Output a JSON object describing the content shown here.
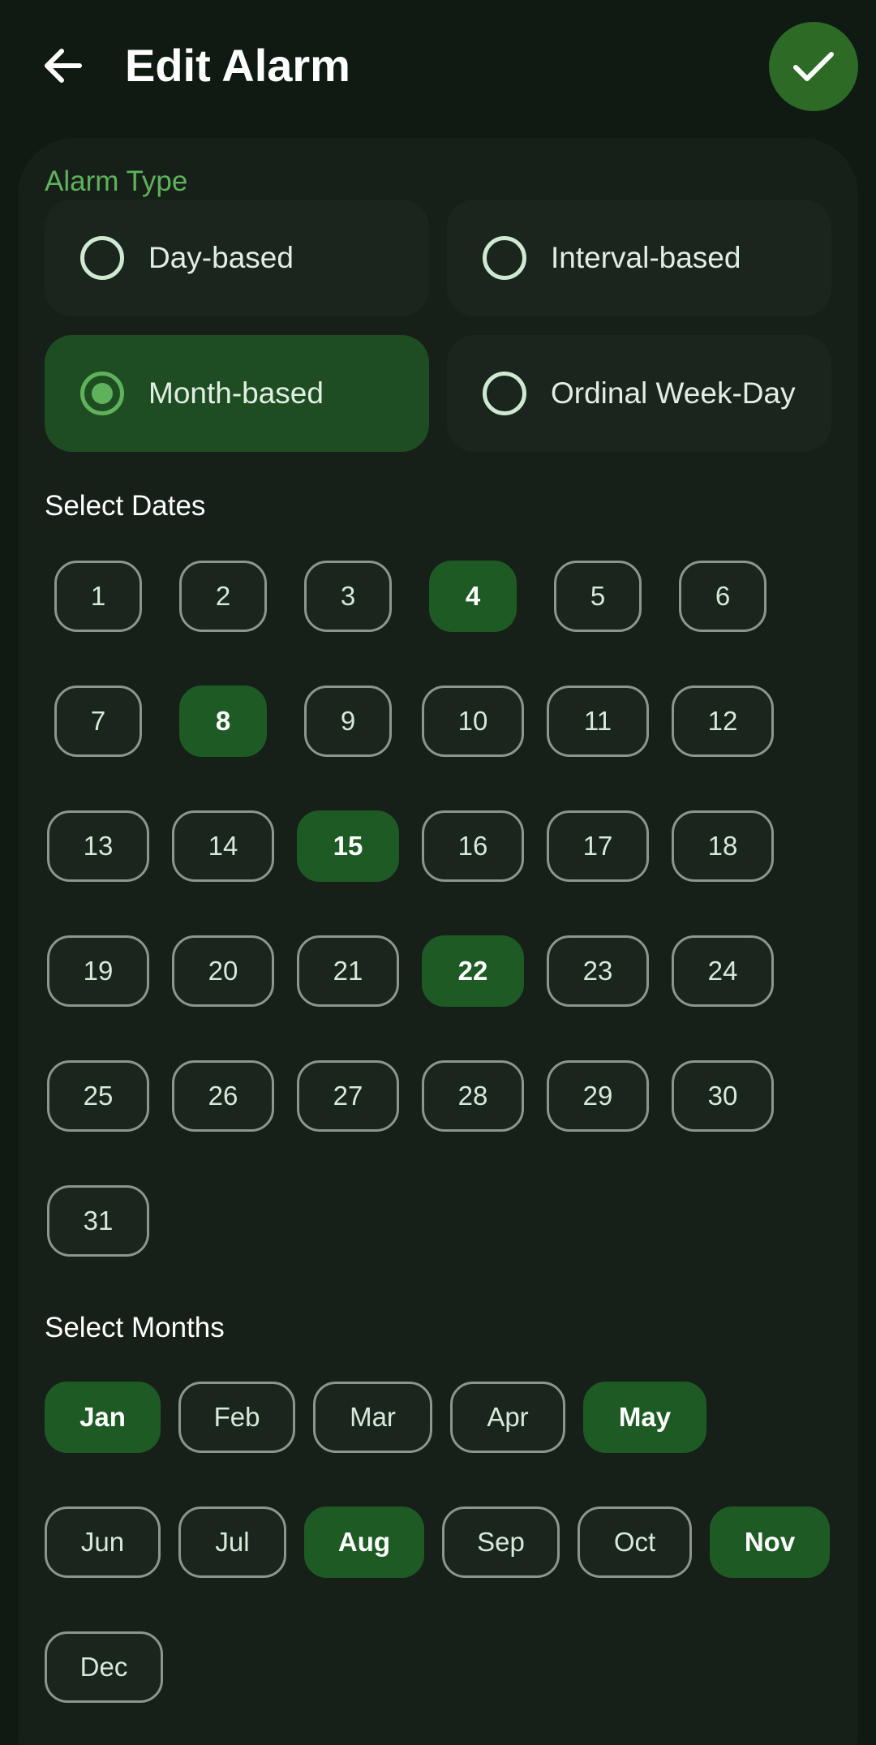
{
  "header": {
    "title": "Edit Alarm",
    "back_icon": "arrow-left-icon",
    "save_icon": "check-icon"
  },
  "alarm_type": {
    "label": "Alarm Type",
    "options": [
      {
        "label": "Day-based",
        "selected": false
      },
      {
        "label": "Interval-based",
        "selected": false
      },
      {
        "label": "Month-based",
        "selected": true
      },
      {
        "label": "Ordinal Week-Day",
        "selected": false
      }
    ]
  },
  "dates": {
    "label": "Select Dates",
    "items": [
      {
        "label": "1",
        "selected": false
      },
      {
        "label": "2",
        "selected": false
      },
      {
        "label": "3",
        "selected": false
      },
      {
        "label": "4",
        "selected": true
      },
      {
        "label": "5",
        "selected": false
      },
      {
        "label": "6",
        "selected": false
      },
      {
        "label": "7",
        "selected": false
      },
      {
        "label": "8",
        "selected": true
      },
      {
        "label": "9",
        "selected": false
      },
      {
        "label": "10",
        "selected": false
      },
      {
        "label": "11",
        "selected": false
      },
      {
        "label": "12",
        "selected": false
      },
      {
        "label": "13",
        "selected": false
      },
      {
        "label": "14",
        "selected": false
      },
      {
        "label": "15",
        "selected": true
      },
      {
        "label": "16",
        "selected": false
      },
      {
        "label": "17",
        "selected": false
      },
      {
        "label": "18",
        "selected": false
      },
      {
        "label": "19",
        "selected": false
      },
      {
        "label": "20",
        "selected": false
      },
      {
        "label": "21",
        "selected": false
      },
      {
        "label": "22",
        "selected": true
      },
      {
        "label": "23",
        "selected": false
      },
      {
        "label": "24",
        "selected": false
      },
      {
        "label": "25",
        "selected": false
      },
      {
        "label": "26",
        "selected": false
      },
      {
        "label": "27",
        "selected": false
      },
      {
        "label": "28",
        "selected": false
      },
      {
        "label": "29",
        "selected": false
      },
      {
        "label": "30",
        "selected": false
      },
      {
        "label": "31",
        "selected": false
      }
    ]
  },
  "months": {
    "label": "Select Months",
    "items": [
      {
        "label": "Jan",
        "selected": true
      },
      {
        "label": "Feb",
        "selected": false
      },
      {
        "label": "Mar",
        "selected": false
      },
      {
        "label": "Apr",
        "selected": false
      },
      {
        "label": "May",
        "selected": true
      },
      {
        "label": "Jun",
        "selected": false
      },
      {
        "label": "Jul",
        "selected": false
      },
      {
        "label": "Aug",
        "selected": true
      },
      {
        "label": "Sep",
        "selected": false
      },
      {
        "label": "Oct",
        "selected": false
      },
      {
        "label": "Nov",
        "selected": true
      },
      {
        "label": "Dec",
        "selected": false
      }
    ]
  },
  "colors": {
    "background": "#0f1a13",
    "card": "#162019",
    "accent": "#5fb25b",
    "selected_chip": "#1e5a24",
    "save_button": "#2d6a26"
  }
}
